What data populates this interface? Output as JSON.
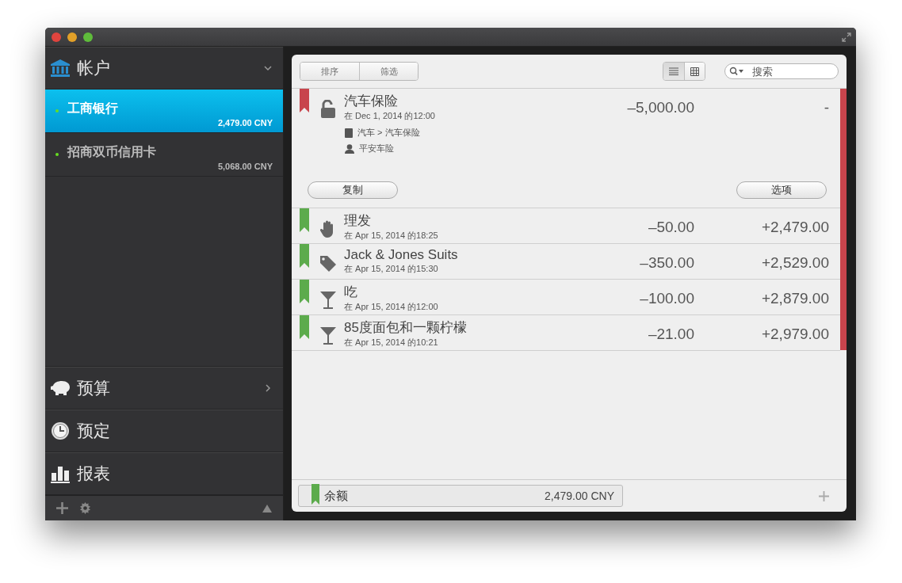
{
  "sidebar": {
    "accounts": {
      "title": "帐户",
      "expanded": true,
      "items": [
        {
          "name": "工商银行",
          "balance": "2,479.00 CNY",
          "selected": true,
          "color": "#66dd22"
        },
        {
          "name": "招商双币信用卡",
          "balance": "5,068.00 CNY",
          "selected": false,
          "color": "#66dd22"
        }
      ]
    },
    "sections": [
      {
        "kind": "budget",
        "title": "预算",
        "expanded": false
      },
      {
        "kind": "scheduled",
        "title": "预定"
      },
      {
        "kind": "reports",
        "title": "报表"
      }
    ]
  },
  "toolbar": {
    "segments": [
      "排序",
      "筛选"
    ],
    "view_modes": [
      {
        "kind": "list",
        "selected": true
      },
      {
        "kind": "grid",
        "selected": false
      }
    ],
    "search": {
      "placeholder": "搜索"
    }
  },
  "transactions": [
    {
      "kind": "lock",
      "color": "#c8444c",
      "title": "汽车保险",
      "date": "在 Dec 1, 2014 的12:00",
      "amount": "–5,000.00",
      "balance": "-",
      "expanded": true,
      "category": "汽车 > 汽车保险",
      "payee": "平安车险",
      "actions": [
        "复制",
        "选项"
      ]
    },
    {
      "kind": "hand",
      "color": "#5cab4c",
      "title": "理发",
      "date": "在 Apr 15, 2014 的18:25",
      "amount": "–50.00",
      "balance": "+2,479.00",
      "expanded": false
    },
    {
      "kind": "tag",
      "color": "#5cab4c",
      "title": "Jack & Jones Suits",
      "date": "在 Apr 15, 2014 的15:30",
      "amount": "–350.00",
      "balance": "+2,529.00",
      "expanded": false
    },
    {
      "kind": "glass",
      "color": "#5cab4c",
      "title": "吃",
      "date": "在 Apr 15, 2014 的12:00",
      "amount": "–100.00",
      "balance": "+2,879.00",
      "expanded": false
    },
    {
      "kind": "glass",
      "color": "#5cab4c",
      "title": "85度面包和一颗柠檬",
      "date": "在 Apr 15, 2014 的10:21",
      "amount": "–21.00",
      "balance": "+2,979.00",
      "expanded": false
    }
  ],
  "footer": {
    "label": "余额",
    "amount": "2,479.00 CNY",
    "color": "#5cab4c"
  }
}
